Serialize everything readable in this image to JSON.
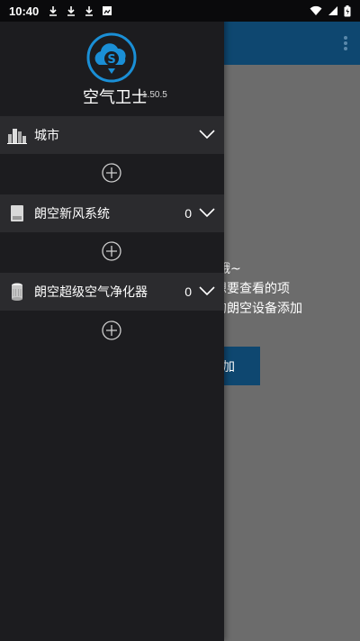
{
  "status_bar": {
    "time": "10:40",
    "icons_left": [
      "download-icon",
      "download-icon",
      "download-icon",
      "screenshot-icon"
    ],
    "icons_right": [
      "wifi-icon",
      "signal-icon",
      "battery-icon"
    ]
  },
  "app": {
    "header_color": "#0e4770",
    "hint_lines": [
      "示的哦~",
      "择您想要查看的项",
      "您家的朗空设备添加"
    ],
    "add_button_label": "加"
  },
  "drawer": {
    "app_name": "空气卫士",
    "version": "1.50.5",
    "sections": [
      {
        "label": "城市",
        "icon": "city-buildings-icon",
        "count": ""
      },
      {
        "label": "朗空新风系统",
        "icon": "fresh-air-unit-icon",
        "count": "0"
      },
      {
        "label": "朗空超级空气净化器",
        "icon": "air-purifier-icon",
        "count": "0"
      }
    ]
  },
  "colors": {
    "drawer_bg": "#1c1c1f",
    "section_bg": "#2b2b2e",
    "logo_blue": "#1a8fd6"
  }
}
